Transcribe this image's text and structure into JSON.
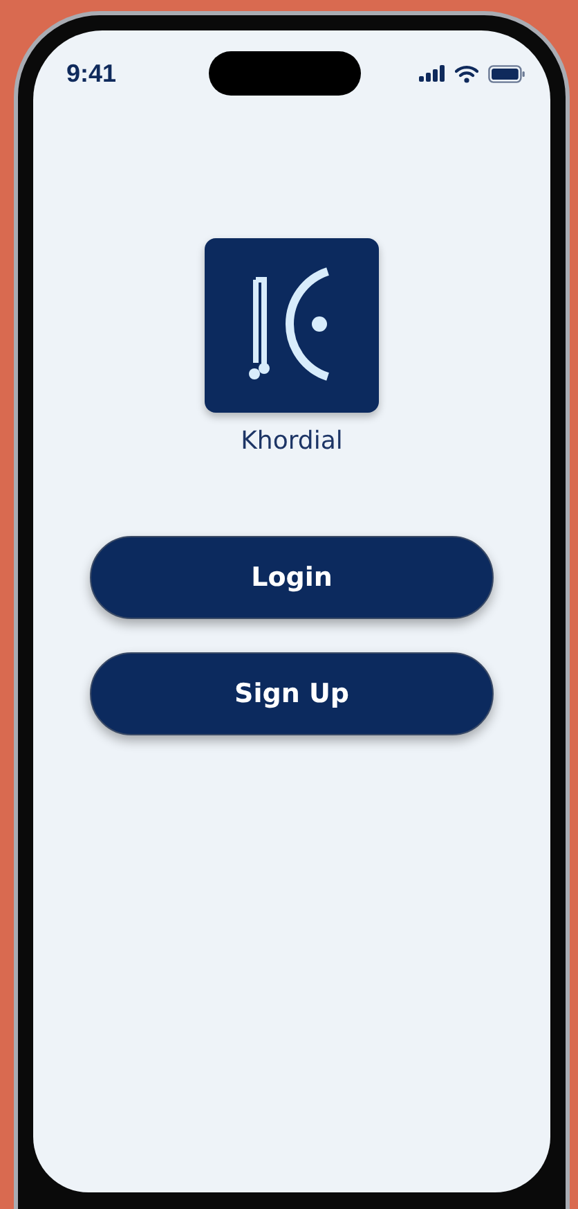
{
  "status_bar": {
    "time": "9:41"
  },
  "app": {
    "name": "Khordial"
  },
  "buttons": [
    {
      "label": "Login"
    },
    {
      "label": "Sign Up"
    }
  ]
}
